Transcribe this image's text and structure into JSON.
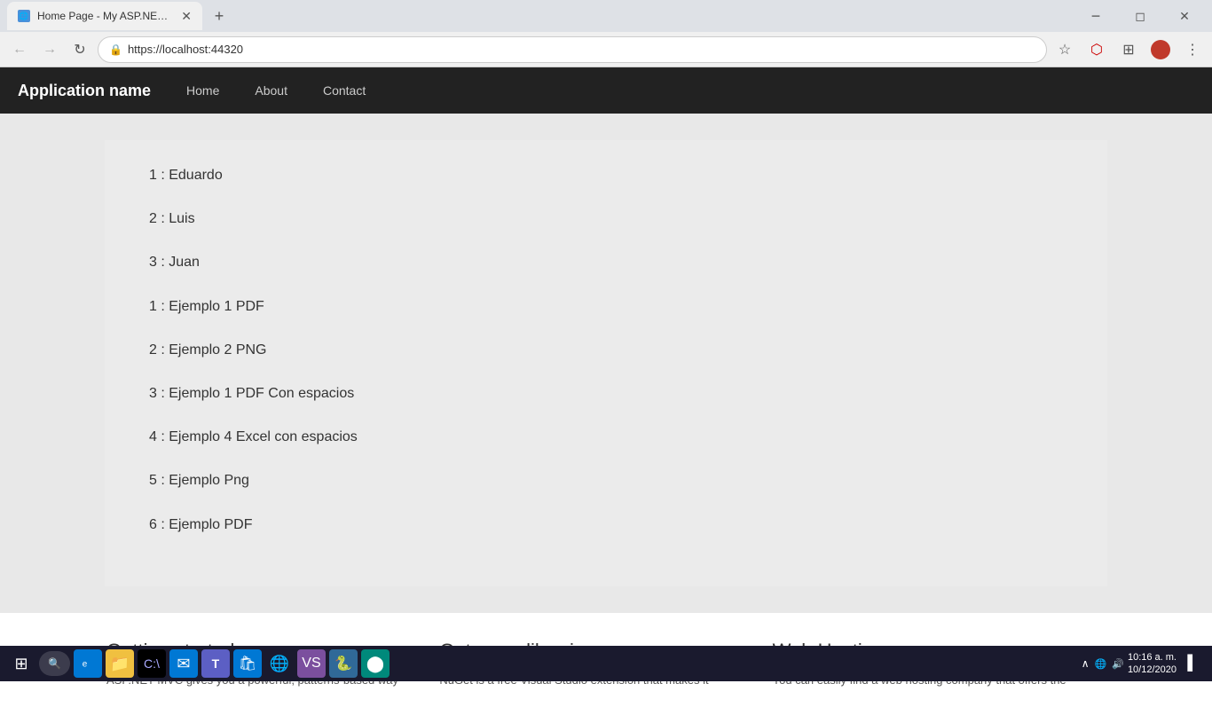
{
  "browser": {
    "tab_title": "Home Page - My ASP.NET Applic...",
    "url": "https://localhost:44320",
    "favicon_text": "🌐"
  },
  "navbar": {
    "brand": "Application name",
    "links": [
      "Home",
      "About",
      "Contact"
    ]
  },
  "content": {
    "items": [
      "1 : Eduardo",
      "2 : Luis",
      "3 : Juan",
      "1 : Ejemplo 1 PDF",
      "2 : Ejemplo 2 PNG",
      "3 : Ejemplo 1 PDF Con espacios",
      "4 : Ejemplo 4 Excel con espacios",
      "5 : Ejemplo Png",
      "6 : Ejemplo PDF"
    ]
  },
  "footer": {
    "columns": [
      {
        "title": "Getting started",
        "text": "ASP.NET MVC gives you a powerful, patterns-based way"
      },
      {
        "title": "Get more libraries",
        "text": "NuGet is a free Visual Studio extension that makes it"
      },
      {
        "title": "Web Hosting",
        "text": "You can easily find a web hosting company that offers the"
      }
    ]
  },
  "taskbar": {
    "time": "10:16 a. m.",
    "date": "10/12/2020"
  }
}
